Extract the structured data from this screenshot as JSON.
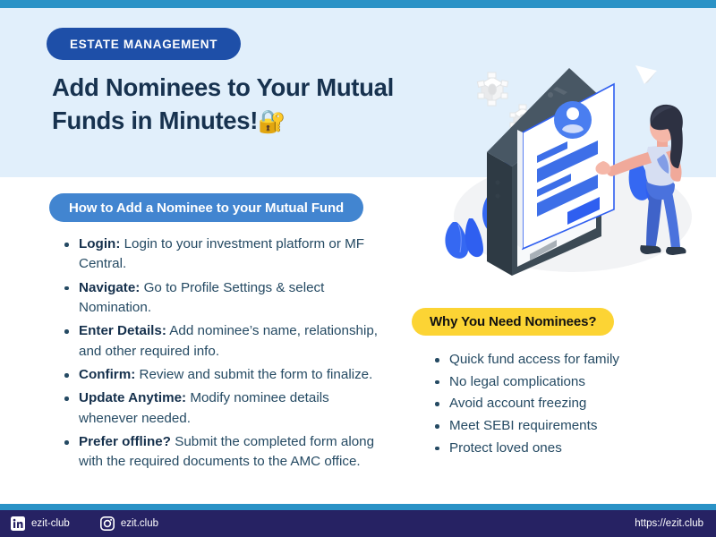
{
  "theme": {
    "accent_bar": "#2a92c6",
    "hero_bg": "#e1effb",
    "badge_bg": "#1e4fa8",
    "pill_blue": "#4285d0",
    "pill_yellow": "#fcd434",
    "text_dark": "#17324f",
    "body_text": "#254a63",
    "footer_bg": "#262263"
  },
  "hero": {
    "badge": "ESTATE MANAGEMENT",
    "title_line1": "Add Nominees to Your Mutual",
    "title_line2": "Funds in Minutes!",
    "title_emoji": "🔐"
  },
  "steps_section": {
    "heading": "How to Add a Nominee to your Mutual Fund",
    "items": [
      {
        "label": "Login:",
        "text": " Login to your investment platform or MF Central."
      },
      {
        "label": "Navigate:",
        "text": " Go to Profile Settings & select Nomination."
      },
      {
        "label": "Enter Details:",
        "text": " Add nominee’s name, relationship, and other required info."
      },
      {
        "label": "Confirm:",
        "text": " Review and submit the form to finalize."
      },
      {
        "label": "Update Anytime:",
        "text": " Modify nominee details whenever needed."
      },
      {
        "label": "Prefer offline?",
        "text": " Submit the completed form along with the required documents to the AMC office."
      }
    ]
  },
  "benefits_section": {
    "heading": "Why You Need Nominees?",
    "items": [
      "Quick fund access for family",
      "No legal complications",
      "Avoid account freezing",
      "Meet SEBI requirements",
      "Protect loved ones"
    ]
  },
  "illustration": {
    "description": "isometric smartphone with profile form and woman tapping screen",
    "elements": [
      "gears",
      "paper-plane",
      "phone",
      "profile-card",
      "person",
      "plants"
    ]
  },
  "footer": {
    "socials": [
      {
        "icon": "linkedin-icon",
        "handle": "ezit-club"
      },
      {
        "icon": "instagram-icon",
        "handle": "ezit.club"
      }
    ],
    "website": "https://ezit.club"
  }
}
